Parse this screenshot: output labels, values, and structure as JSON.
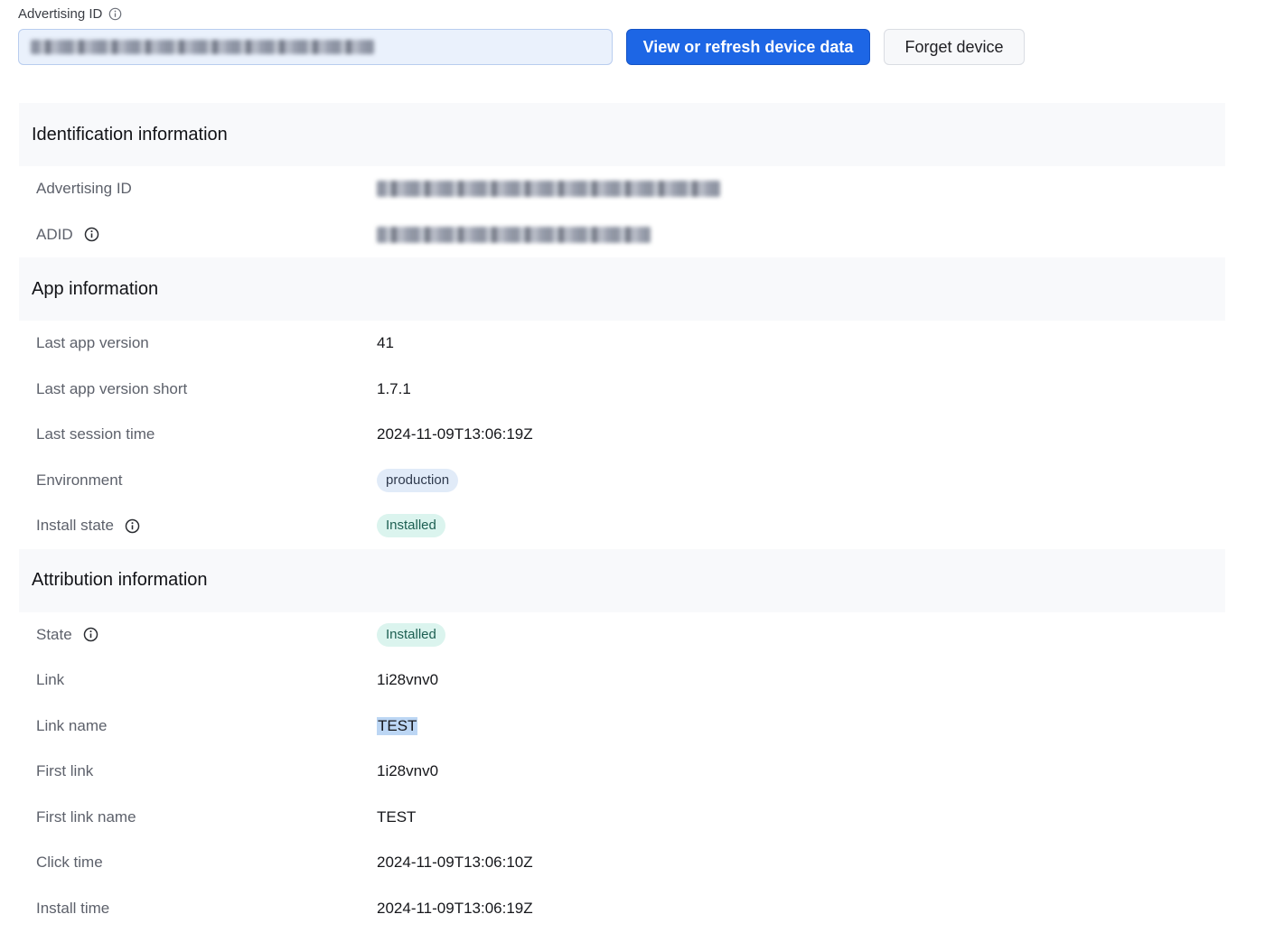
{
  "top": {
    "label": "Advertising ID",
    "primary_button": "View or refresh device data",
    "secondary_button": "Forget device"
  },
  "sections": {
    "identification": {
      "title": "Identification information",
      "rows": [
        {
          "key": "Advertising ID"
        },
        {
          "key": "ADID"
        }
      ]
    },
    "app": {
      "title": "App information",
      "rows": [
        {
          "key": "Last app version",
          "value": "41"
        },
        {
          "key": "Last app version short",
          "value": "1.7.1"
        },
        {
          "key": "Last session time",
          "value": "2024-11-09T13:06:19Z"
        },
        {
          "key": "Environment",
          "value": "production"
        },
        {
          "key": "Install state",
          "value": "Installed"
        }
      ]
    },
    "attribution": {
      "title": "Attribution information",
      "rows": [
        {
          "key": "State",
          "value": "Installed"
        },
        {
          "key": "Link",
          "value": "1i28vnv0"
        },
        {
          "key": "Link name",
          "value": "TEST"
        },
        {
          "key": "First link",
          "value": "1i28vnv0"
        },
        {
          "key": "First link name",
          "value": "TEST"
        },
        {
          "key": "Click time",
          "value": "2024-11-09T13:06:10Z"
        },
        {
          "key": "Install time",
          "value": "2024-11-09T13:06:19Z"
        }
      ]
    }
  },
  "colors": {
    "primary": "#1d66e5",
    "pill_production": "#e1ebf8",
    "pill_installed": "#dbf4ee",
    "section_bg": "#f8f9fb"
  },
  "icons": {
    "info": "info-circle-icon"
  }
}
